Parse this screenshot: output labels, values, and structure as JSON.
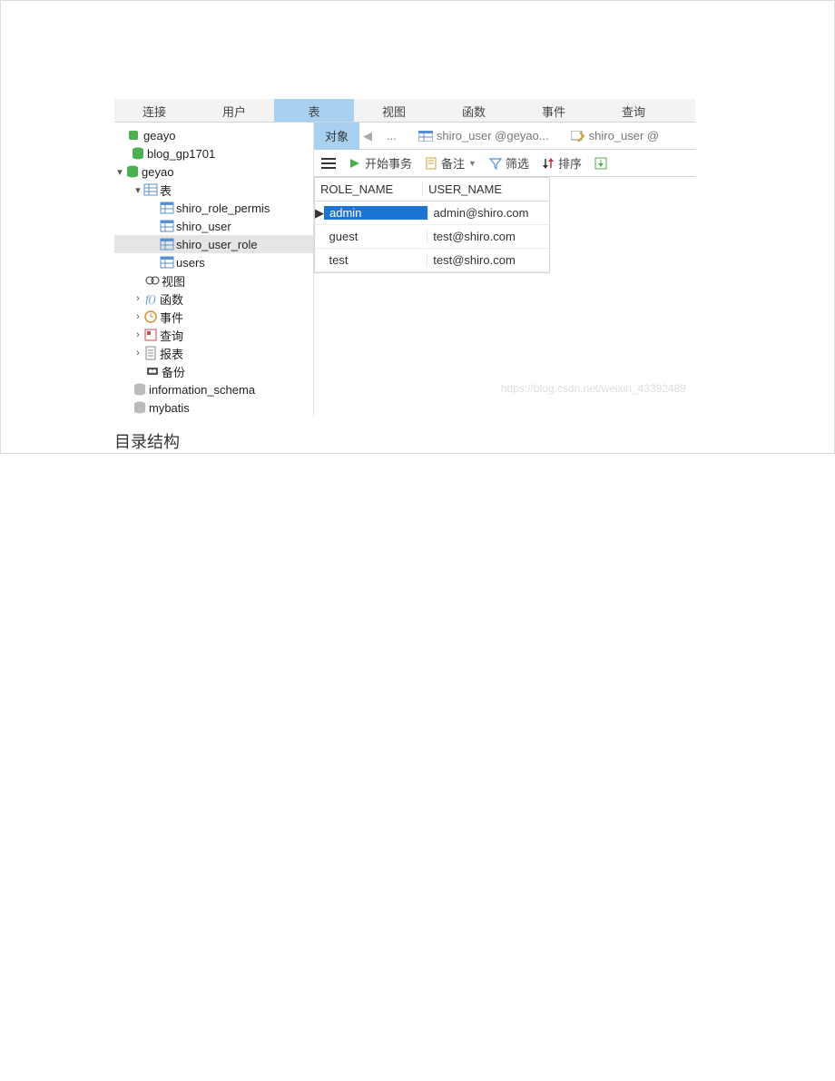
{
  "menubar": {
    "items": [
      "连接",
      "用户",
      "表",
      "视图",
      "函数",
      "事件",
      "查询"
    ],
    "active_index": 2
  },
  "tree": {
    "conn1": {
      "label": "geayo"
    },
    "db1": {
      "label": "blog_gp1701"
    },
    "db2": {
      "label": "geyao"
    },
    "tables_group": {
      "label": "表"
    },
    "tables": [
      {
        "label": "shiro_role_permis"
      },
      {
        "label": "shiro_user"
      },
      {
        "label": "shiro_user_role",
        "selected": true
      },
      {
        "label": "users"
      }
    ],
    "views": {
      "label": "视图"
    },
    "functions": {
      "label": "函数"
    },
    "events": {
      "label": "事件"
    },
    "queries": {
      "label": "查询"
    },
    "reports": {
      "label": "报表"
    },
    "backups": {
      "label": "备份"
    },
    "db3": {
      "label": "information_schema"
    },
    "db4": {
      "label": "mybatis"
    }
  },
  "tabs": {
    "objects": "对象",
    "back": "...",
    "t1": "shiro_user @geyao...",
    "t2": "shiro_user @"
  },
  "toolbar": {
    "start_tx": "开始事务",
    "memo": "备注",
    "filter": "筛选",
    "sort": "排序"
  },
  "grid": {
    "headers": [
      "ROLE_NAME",
      "USER_NAME"
    ],
    "rows": [
      {
        "role": "admin",
        "user": "admin@shiro.com",
        "selected": true
      },
      {
        "role": "guest",
        "user": "test@shiro.com"
      },
      {
        "role": "test",
        "user": "test@shiro.com"
      }
    ]
  },
  "watermark": "https://blog.csdn.net/weixin_43392489",
  "caption": "目录结构"
}
